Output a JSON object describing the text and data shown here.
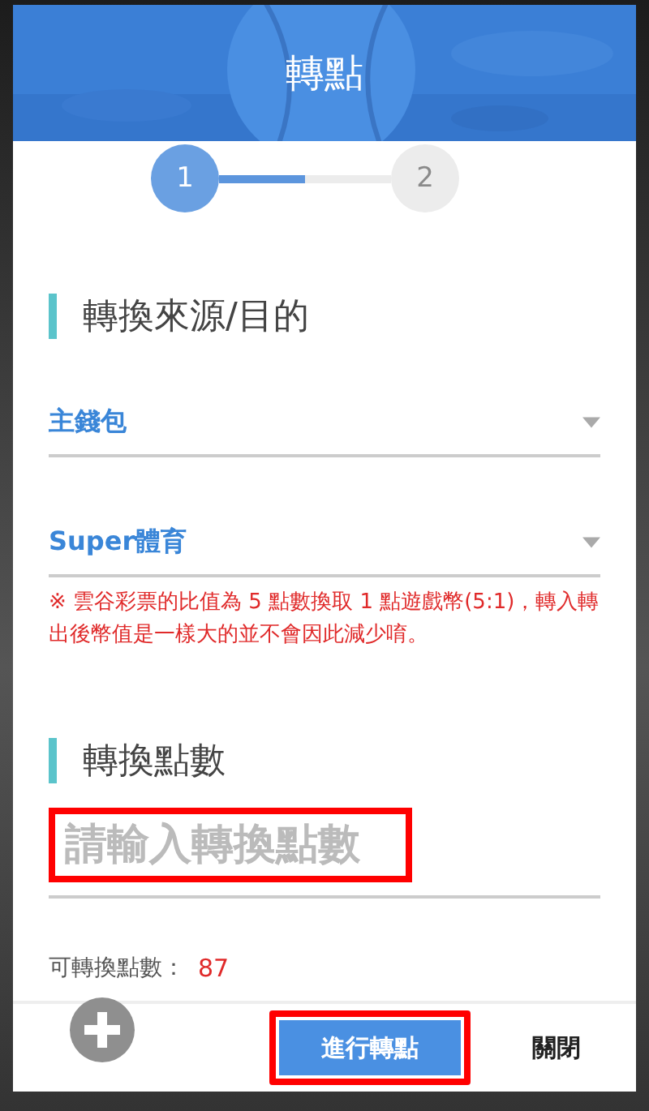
{
  "dialog": {
    "title": "轉點"
  },
  "steps": [
    {
      "label": "1",
      "selected": true
    },
    {
      "label": "2",
      "selected": false
    }
  ],
  "step_progress": {
    "level": 0.5
  },
  "source_section": {
    "title": "轉換來源/目的"
  },
  "selects": [
    {
      "value": "主錢包"
    },
    {
      "value": "Super體育"
    }
  ],
  "notice": "※ 雲谷彩票的比值為 5 點數換取 1 點遊戲幣(5:1)，轉入轉出後幣值是一樣大的並不會因此減少唷。",
  "amount_section": {
    "title": "轉換點數"
  },
  "amount_field": {
    "placeholder": "請輸入轉換點數",
    "highlighted": true
  },
  "available": {
    "label": "可轉換點數：",
    "value": "87"
  },
  "buttons": [
    {
      "kind": "primary",
      "label": "進行轉點",
      "highlighted": true
    },
    {
      "kind": "text",
      "label": "關閉",
      "highlighted": false
    }
  ]
}
